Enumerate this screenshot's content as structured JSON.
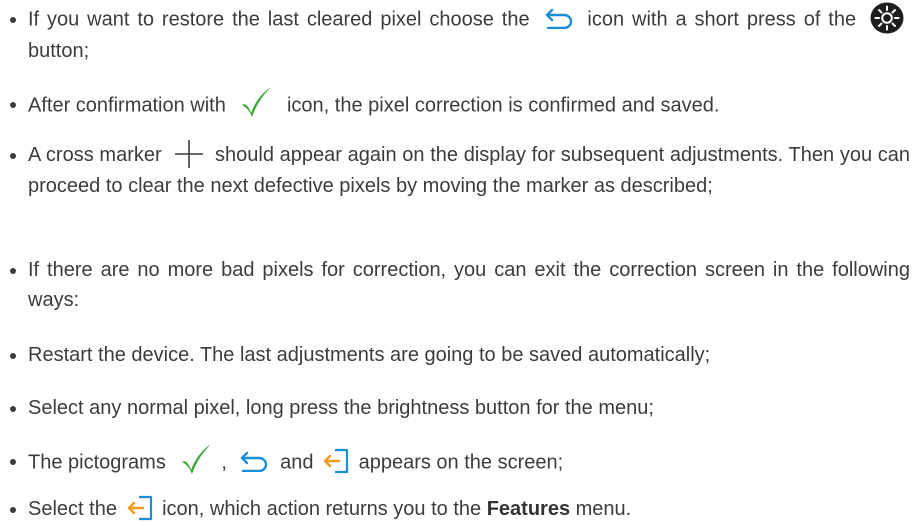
{
  "icons": {
    "back": "undo-arrow-icon",
    "brightness": "brightness-button-icon",
    "check": "checkmark-icon",
    "cross": "cross-marker-icon",
    "exit": "exit-icon"
  },
  "colors": {
    "text": "#3c3c3c",
    "accent_blue": "#1a8fd6",
    "check_green": "#3aa635",
    "exit_orange": "#f39a1f",
    "dark_button": "#1e1e1e"
  },
  "bullets": {
    "b1": {
      "part1": "If you want to restore the last cleared pixel choose the",
      "part2": "icon with a short press of the",
      "part3": "button;"
    },
    "b2": {
      "part1": "After confirmation with",
      "part2": "icon, the pixel correction is confirmed and saved."
    },
    "b3": {
      "part1": "A cross marker",
      "part2": "should appear again on the display for subsequent adjustments. Then you can proceed to clear the next defective pixels by moving the marker as described;"
    },
    "b4": {
      "text": "If there are no more bad pixels for correction, you can exit the correction screen in the following ways:"
    },
    "b5": {
      "text": "Restart the device. The last adjustments are going to be saved automatically;"
    },
    "b6": {
      "text": "Select any normal pixel, long press the brightness button for the menu;"
    },
    "b7": {
      "part1": "The pictograms",
      "part2": ",",
      "part3": "and",
      "part4": "appears on the screen;"
    },
    "b8": {
      "part1": "Select the",
      "part2": "icon, which action returns you to the",
      "bold": "Features",
      "part3": "menu."
    }
  }
}
